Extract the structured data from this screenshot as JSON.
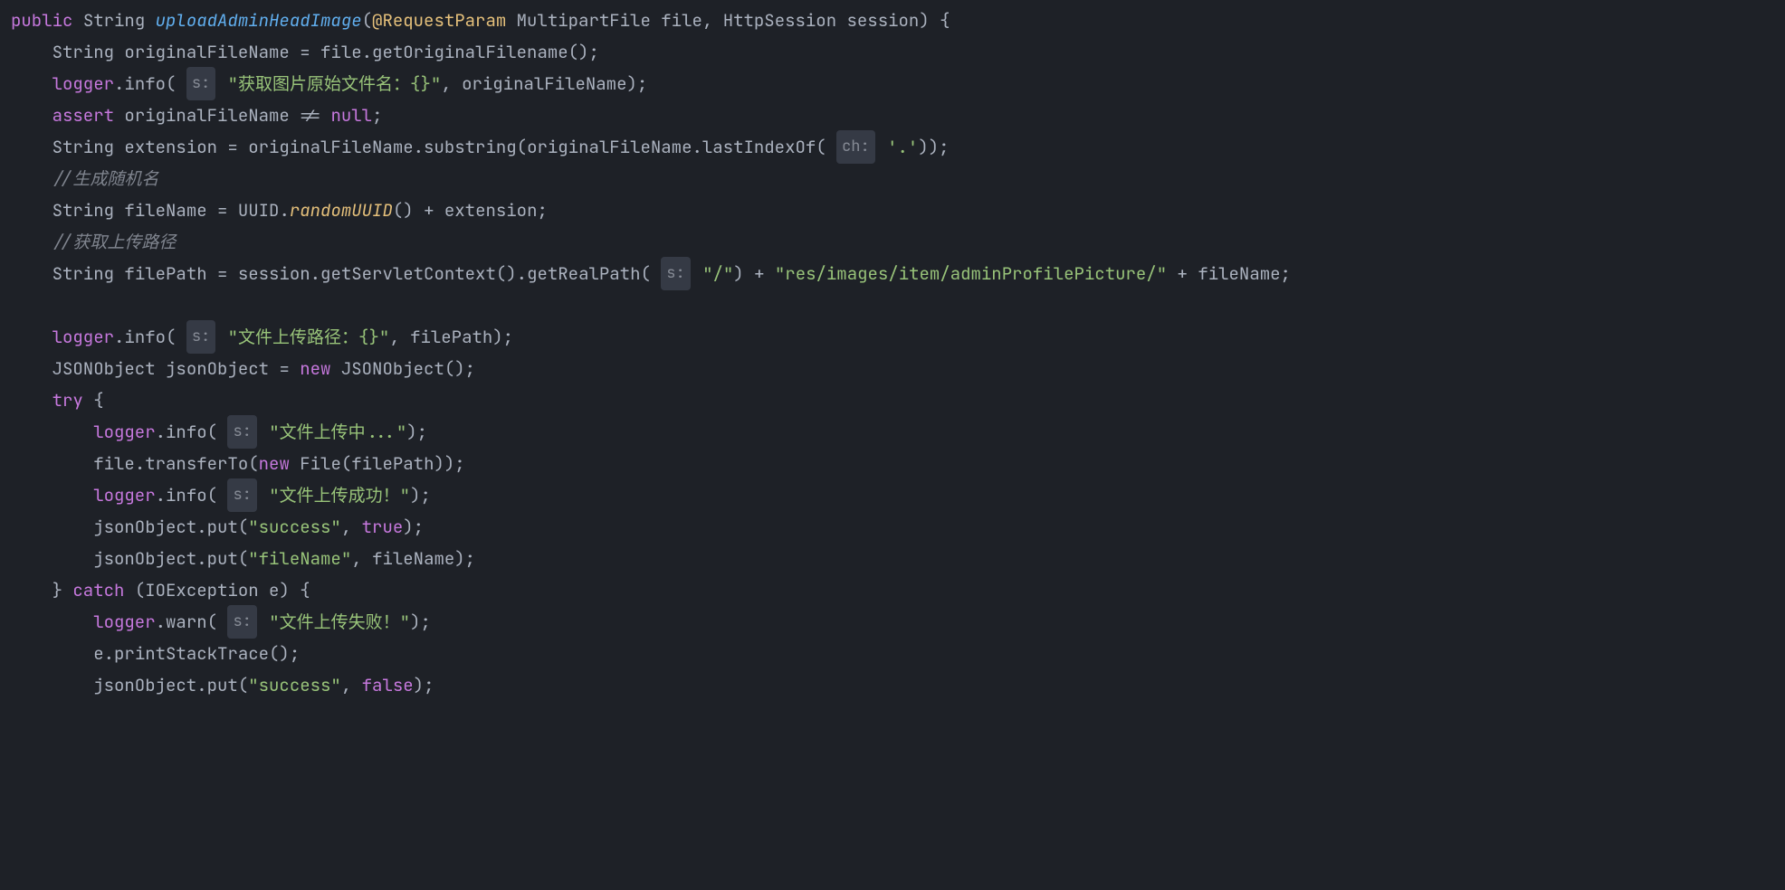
{
  "code": {
    "line1": {
      "kw_public": "public",
      "type_string": "String",
      "method": "uploadAdminHeadImage",
      "annotation": "@RequestParam",
      "type_multipart": "MultipartFile",
      "param_file": "file",
      "type_session": "HttpSession",
      "param_session": "session"
    },
    "line2": {
      "type": "String",
      "var": "originalFileName",
      "expr_obj": "file",
      "expr_method": "getOriginalFilename"
    },
    "line3": {
      "logger": "logger",
      "method": "info",
      "hint": "s:",
      "str": "\"获取图片原始文件名：{}\"",
      "arg": "originalFileName"
    },
    "line4": {
      "kw": "assert",
      "var": "originalFileName",
      "op": "!=",
      "null": "null"
    },
    "line5": {
      "type": "String",
      "var": "extension",
      "obj": "originalFileName",
      "m1": "substring",
      "obj2": "originalFileName",
      "m2": "lastIndexOf",
      "hint": "ch:",
      "char": "'.'"
    },
    "line6": {
      "comment": "//生成随机名"
    },
    "line7": {
      "type": "String",
      "var": "fileName",
      "cls": "UUID",
      "method": "randomUUID",
      "plus": "+",
      "arg": "extension"
    },
    "line8": {
      "comment": "//获取上传路径"
    },
    "line9": {
      "type": "String",
      "var": "filePath",
      "obj": "session",
      "m1": "getServletContext",
      "m2": "getRealPath",
      "hint": "s:",
      "str1": "\"/\"",
      "str2": "\"res/images/item/adminProfilePicture/\"",
      "arg": "fileName"
    },
    "line11": {
      "logger": "logger",
      "method": "info",
      "hint": "s:",
      "str": "\"文件上传路径：{}\"",
      "arg": "filePath"
    },
    "line12": {
      "type": "JSONObject",
      "var": "jsonObject",
      "kw": "new",
      "ctor": "JSONObject"
    },
    "line13": {
      "kw": "try"
    },
    "line14": {
      "logger": "logger",
      "method": "info",
      "hint": "s:",
      "str": "\"文件上传中...\""
    },
    "line15": {
      "obj": "file",
      "method": "transferTo",
      "kw": "new",
      "ctor": "File",
      "arg": "filePath"
    },
    "line16": {
      "logger": "logger",
      "method": "info",
      "hint": "s:",
      "str": "\"文件上传成功！\""
    },
    "line17": {
      "obj": "jsonObject",
      "method": "put",
      "key": "\"success\"",
      "val": "true"
    },
    "line18": {
      "obj": "jsonObject",
      "method": "put",
      "key": "\"fileName\"",
      "val": "fileName"
    },
    "line19": {
      "kw": "catch",
      "type": "IOException",
      "var": "e"
    },
    "line20": {
      "logger": "logger",
      "method": "warn",
      "hint": "s:",
      "str": "\"文件上传失败！\""
    },
    "line21": {
      "obj": "e",
      "method": "printStackTrace"
    },
    "line22": {
      "obj": "jsonObject",
      "method": "put",
      "key": "\"success\"",
      "val": "false"
    }
  }
}
